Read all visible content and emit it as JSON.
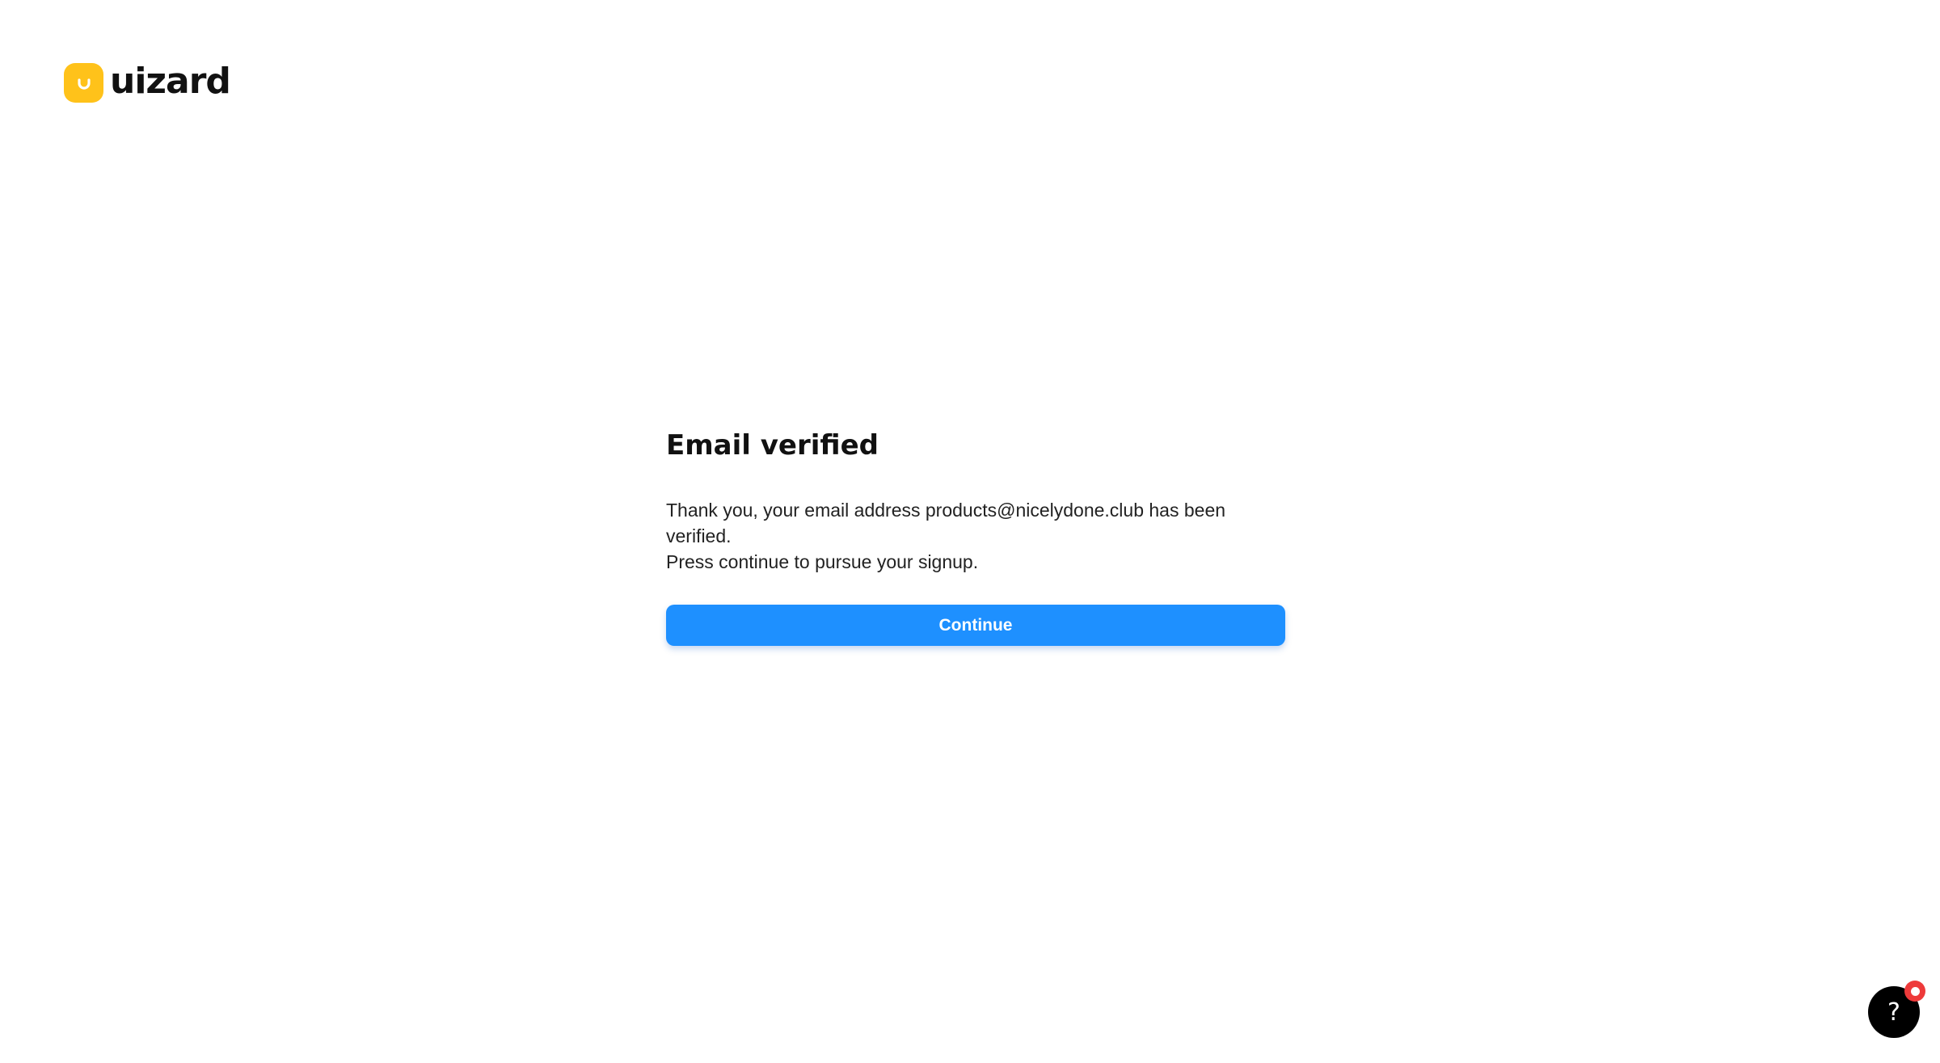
{
  "brand": {
    "name": "uizard",
    "accent_color": "#ffc21a"
  },
  "verification": {
    "title": "Email verified",
    "message_line1": "Thank you, your email address products@nicelydone.club has been verified.",
    "message_line2": "Press continue to pursue your signup.",
    "continue_label": "Continue",
    "button_color": "#1e90ff"
  },
  "help": {
    "icon_glyph": "?",
    "icon": "question-mark-icon",
    "badge_color": "#ee3a3a"
  }
}
